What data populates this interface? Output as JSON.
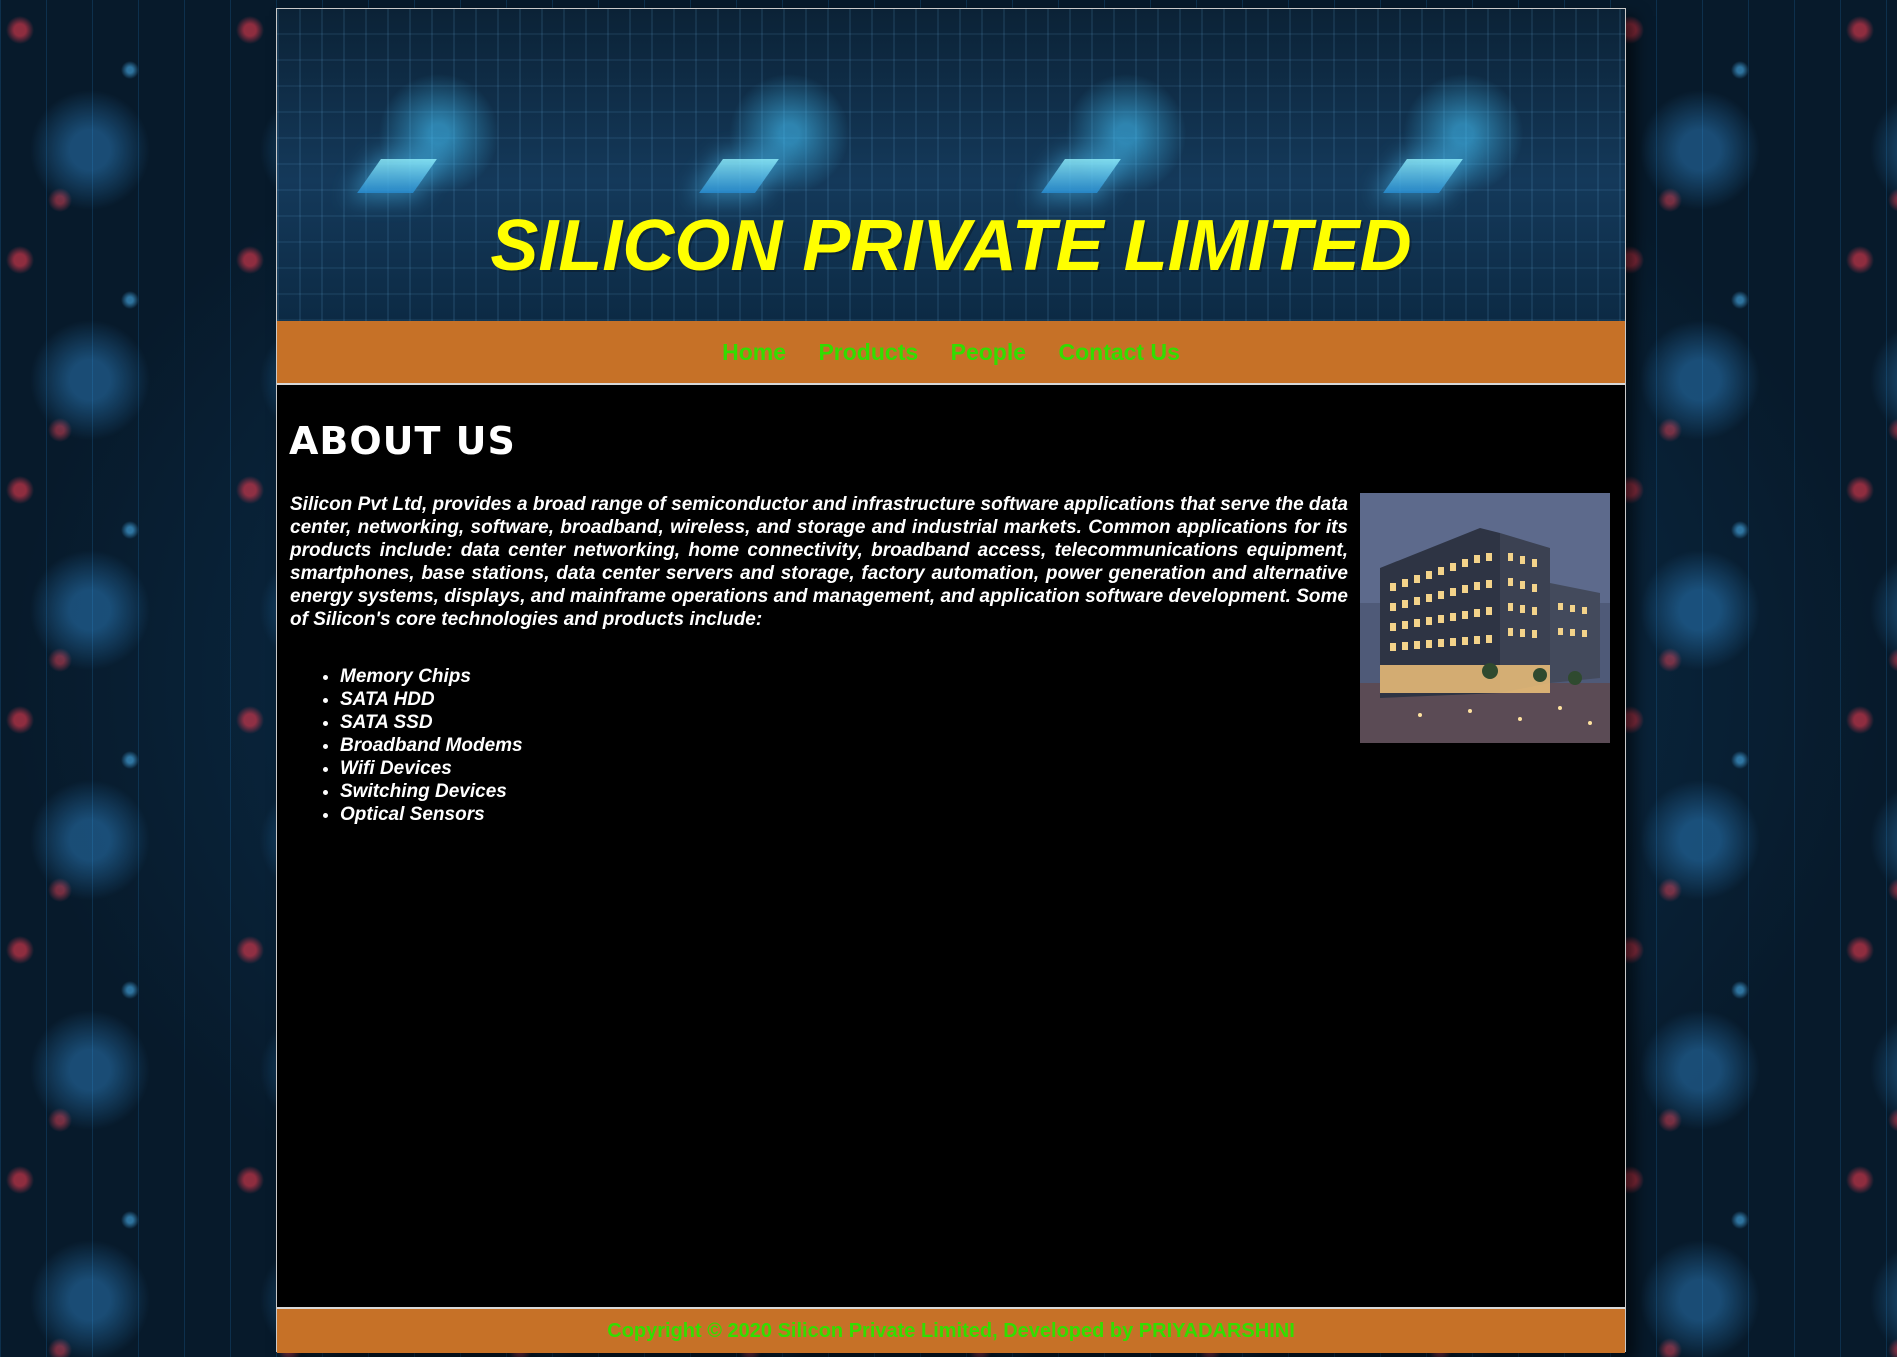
{
  "header": {
    "title": "SILICON PRIVATE LIMITED"
  },
  "nav": {
    "items": [
      {
        "label": "Home"
      },
      {
        "label": "Products"
      },
      {
        "label": "People"
      },
      {
        "label": "Contact Us"
      }
    ]
  },
  "main": {
    "heading": "ABOUT US",
    "paragraph": "Silicon Pvt Ltd, provides a broad range of semiconductor and infrastructure software applications that serve the data center, networking, software, broadband, wireless, and storage and industrial markets. Common applications for its products include: data center networking, home connectivity, broadband access, telecommunications equipment, smartphones, base stations, data center servers and storage, factory automation, power generation and alternative energy systems, displays, and mainframe operations and management, and application software development. Some of Silicon's core technologies and products include:",
    "technologies": [
      "Memory Chips",
      "SATA HDD",
      "SATA SSD",
      "Broadband Modems",
      "Wifi Devices",
      "Switching Devices",
      "Optical Sensors"
    ]
  },
  "footer": {
    "text": "Copyright © 2020 Silicon Private Limited, Developed by PRIYADARSHINI"
  },
  "colors": {
    "title": "#ffff00",
    "nav_bar": "#c67127",
    "nav_link": "#33dd00",
    "main_bg": "#000000",
    "main_text": "#ffffff"
  }
}
